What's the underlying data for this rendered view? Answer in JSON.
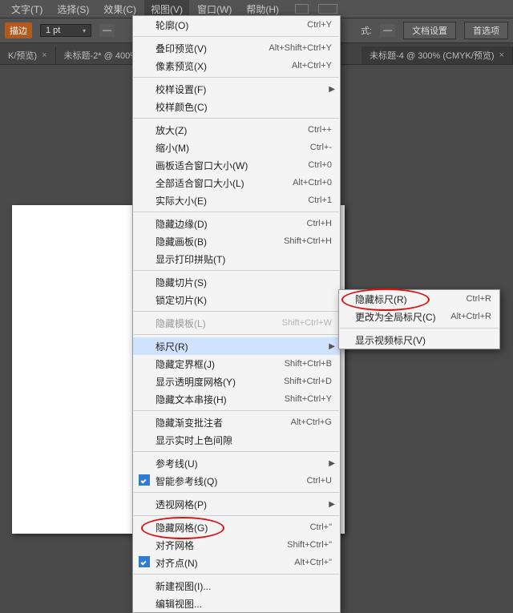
{
  "menubar": {
    "items": [
      "文字(T)",
      "选择(S)",
      "效果(C)",
      "视图(V)",
      "窗口(W)",
      "帮助(H)"
    ]
  },
  "optbar": {
    "orange": "描边",
    "pt": "1 pt",
    "style_label": "式:",
    "btn1": "文档设置",
    "btn2": "首选项"
  },
  "tabs": [
    {
      "label": "K/预览)",
      "close": "×"
    },
    {
      "label": "未标题-2* @ 400% (",
      "close": ""
    },
    {
      "label": "未标题-4 @ 300% (CMYK/预览)",
      "close": "×"
    }
  ],
  "menu": {
    "groups": [
      [
        {
          "label": "轮廓(O)",
          "sc": "Ctrl+Y"
        }
      ],
      [
        {
          "label": "叠印预览(V)",
          "sc": "Alt+Shift+Ctrl+Y"
        },
        {
          "label": "像素预览(X)",
          "sc": "Alt+Ctrl+Y"
        }
      ],
      [
        {
          "label": "校样设置(F)",
          "arrow": true
        },
        {
          "label": "校样颜色(C)"
        }
      ],
      [
        {
          "label": "放大(Z)",
          "sc": "Ctrl++"
        },
        {
          "label": "缩小(M)",
          "sc": "Ctrl+-"
        },
        {
          "label": "画板适合窗口大小(W)",
          "sc": "Ctrl+0"
        },
        {
          "label": "全部适合窗口大小(L)",
          "sc": "Alt+Ctrl+0"
        },
        {
          "label": "实际大小(E)",
          "sc": "Ctrl+1"
        }
      ],
      [
        {
          "label": "隐藏边缘(D)",
          "sc": "Ctrl+H"
        },
        {
          "label": "隐藏画板(B)",
          "sc": "Shift+Ctrl+H"
        },
        {
          "label": "显示打印拼贴(T)"
        }
      ],
      [
        {
          "label": "隐藏切片(S)"
        },
        {
          "label": "锁定切片(K)"
        }
      ],
      [
        {
          "label": "隐藏模板(L)",
          "sc": "Shift+Ctrl+W",
          "disabled": true
        }
      ],
      [
        {
          "label": "标尺(R)",
          "arrow": true,
          "highlight": true
        },
        {
          "label": "隐藏定界框(J)",
          "sc": "Shift+Ctrl+B"
        },
        {
          "label": "显示透明度网格(Y)",
          "sc": "Shift+Ctrl+D"
        },
        {
          "label": "隐藏文本串接(H)",
          "sc": "Shift+Ctrl+Y"
        }
      ],
      [
        {
          "label": "隐藏渐变批注者",
          "sc": "Alt+Ctrl+G"
        },
        {
          "label": "显示实时上色间隙"
        }
      ],
      [
        {
          "label": "参考线(U)",
          "arrow": true
        },
        {
          "label": "智能参考线(Q)",
          "sc": "Ctrl+U",
          "checked": true
        }
      ],
      [
        {
          "label": "透视网格(P)",
          "arrow": true
        }
      ],
      [
        {
          "label": "隐藏网格(G)",
          "sc": "Ctrl+\"",
          "circled": true
        },
        {
          "label": "对齐网格",
          "sc": "Shift+Ctrl+\""
        },
        {
          "label": "对齐点(N)",
          "sc": "Alt+Ctrl+\"",
          "checked": true
        }
      ],
      [
        {
          "label": "新建视图(I)..."
        },
        {
          "label": "编辑视图..."
        }
      ]
    ]
  },
  "submenu": {
    "items": [
      {
        "label": "隐藏标尺(R)",
        "sc": "Ctrl+R",
        "circled": true
      },
      {
        "label": "更改为全局标尺(C)",
        "sc": "Alt+Ctrl+R"
      }
    ],
    "sep_after": 1,
    "rest": [
      {
        "label": "显示视频标尺(V)"
      }
    ]
  }
}
